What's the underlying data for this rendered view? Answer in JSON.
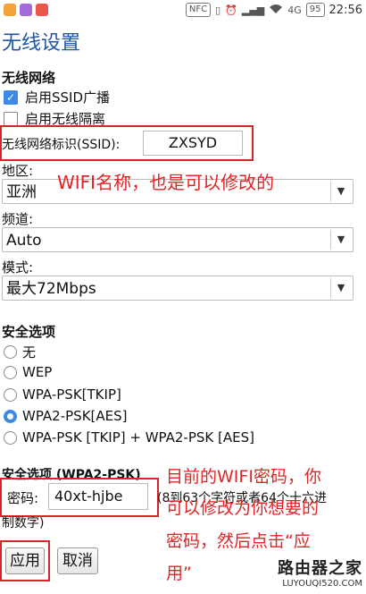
{
  "status_bar": {
    "icons": [
      "nfc-icon",
      "vibrate-icon",
      "alarm-icon",
      "signal-icon",
      "wifi-icon"
    ],
    "network": "4G",
    "battery": "95",
    "time": "22:56",
    "app_colors": [
      "#f2a33a",
      "#a36bd8",
      "#e8564c"
    ]
  },
  "page": {
    "title": "无线设置"
  },
  "wireless_network": {
    "section_label": "无线网络",
    "broadcast_ssid": {
      "label": "启用SSID广播",
      "checked": true
    },
    "isolation": {
      "label": "启用无线隔离",
      "checked": false
    },
    "ssid_label": "无线网络标识(SSID):",
    "ssid_value": "ZXSYD"
  },
  "region": {
    "label": "地区:",
    "value": "亚洲"
  },
  "channel": {
    "label": "频道:",
    "value": "Auto"
  },
  "mode": {
    "label": "模式:",
    "value": "最大72Mbps"
  },
  "security": {
    "section_label": "安全选项",
    "options": [
      {
        "label": "无",
        "selected": false
      },
      {
        "label": "WEP",
        "selected": false
      },
      {
        "label": "WPA-PSK[TKIP]",
        "selected": false
      },
      {
        "label": "WPA2-PSK[AES]",
        "selected": true
      },
      {
        "label": "WPA-PSK [TKIP] + WPA2-PSK [AES]",
        "selected": false
      }
    ]
  },
  "wpa2": {
    "section_label": "安全选项 (WPA2-PSK)",
    "password_label": "密码:",
    "password_value": "40xt-hjbe",
    "hint_line1": "(8到63个字符或者64个十六进",
    "hint_line2": "制数字)"
  },
  "buttons": {
    "apply": "应用",
    "cancel": "取消"
  },
  "annotations": {
    "ssid_note": "WIFI名称，也是可以修改的",
    "password_note_lines": [
      "目前的WIFI密码，你",
      "可以修改为你想要的",
      "密码，然后点击“应",
      "用”"
    ]
  },
  "watermark": {
    "title": "路由器之家",
    "url": "LUYOUQI520.COM"
  },
  "colors": {
    "accent": "#3c8ae6",
    "title": "#1d57a8",
    "annotation": "#e22325"
  }
}
